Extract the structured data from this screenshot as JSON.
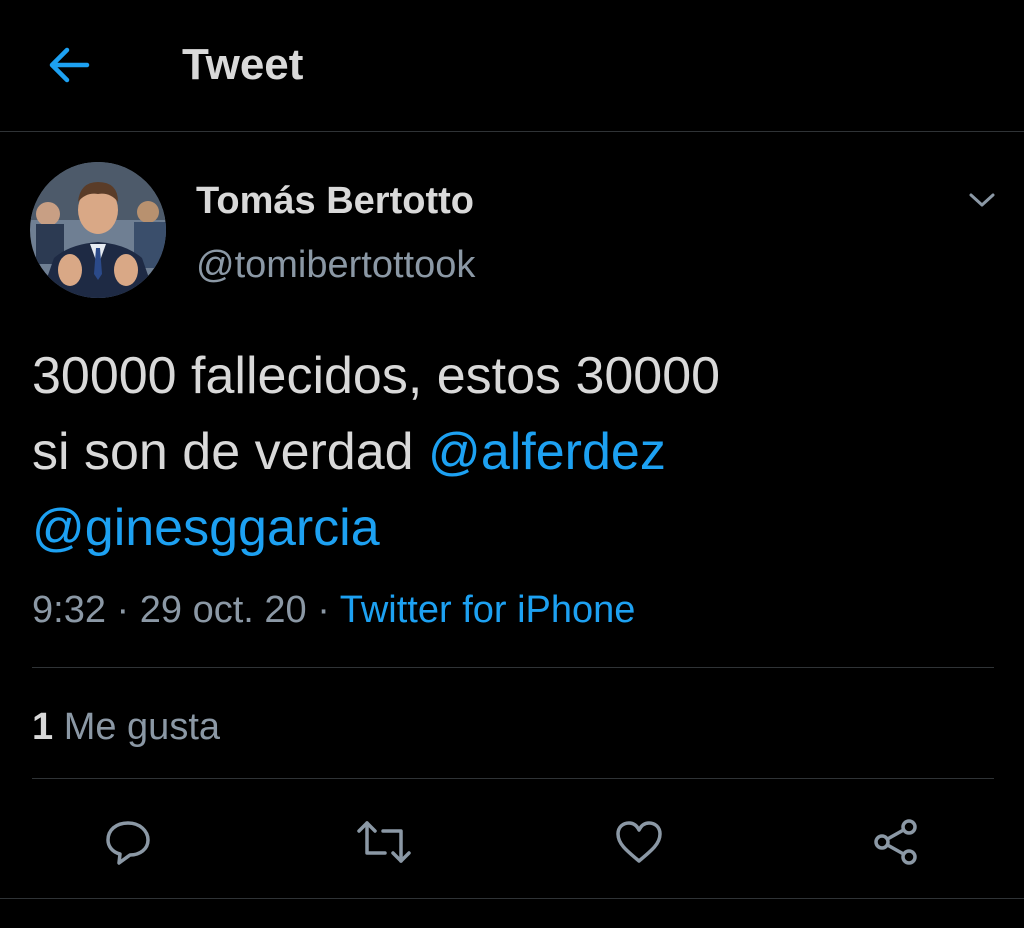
{
  "header": {
    "title": "Tweet",
    "back_icon": "arrow-left-icon"
  },
  "colors": {
    "accent": "#1da1f2",
    "background": "#000000",
    "text": "#d9d9d9",
    "secondary": "#8b98a5"
  },
  "tweet": {
    "author_name": "Tomás Bertotto",
    "author_handle": "@tomibertottook",
    "text_line1": "30000 fallecidos, estos 30000",
    "text_line2_plain": "si son de verdad",
    "mention1": "@alferdez",
    "mention2": "@ginesggarcia",
    "time": "9:32",
    "date": "29 oct. 20",
    "separator": "·",
    "source": "Twitter for iPhone"
  },
  "stats": {
    "likes_count": "1",
    "likes_label": "Me gusta"
  },
  "actions": [
    {
      "icon": "reply-icon"
    },
    {
      "icon": "retweet-icon"
    },
    {
      "icon": "like-icon"
    },
    {
      "icon": "share-icon"
    }
  ]
}
